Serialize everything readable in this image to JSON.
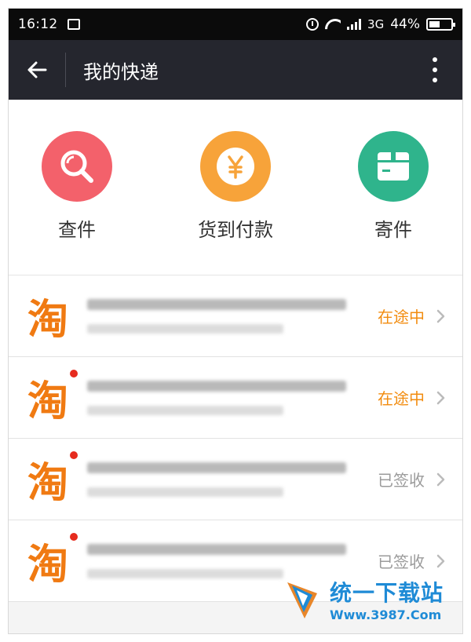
{
  "statusbar": {
    "time": "16:12",
    "network": "3G",
    "battery": "44%",
    "battery_level": 0.44
  },
  "appbar": {
    "title": "我的快递"
  },
  "actions": [
    {
      "label": "查件",
      "icon": "search-icon",
      "color": "#f3616b"
    },
    {
      "label": "货到付款",
      "icon": "yen-icon",
      "color": "#f7a33a"
    },
    {
      "label": "寄件",
      "icon": "box-icon",
      "color": "#2fb48c"
    }
  ],
  "shipments": [
    {
      "logo": "淘",
      "status": "在途中",
      "status_type": "transit",
      "unread": false
    },
    {
      "logo": "淘",
      "status": "在途中",
      "status_type": "transit",
      "unread": true
    },
    {
      "logo": "淘",
      "status": "已签收",
      "status_type": "signed",
      "unread": true
    },
    {
      "logo": "淘",
      "status": "已签收",
      "status_type": "signed",
      "unread": true
    }
  ],
  "watermark": {
    "name": "统一下载站",
    "url": "Www.3987.Com"
  },
  "colors": {
    "transit": "#f28c0f",
    "signed": "#9b9b9b",
    "appbar": "#25262e",
    "brand": "#f07a12"
  }
}
